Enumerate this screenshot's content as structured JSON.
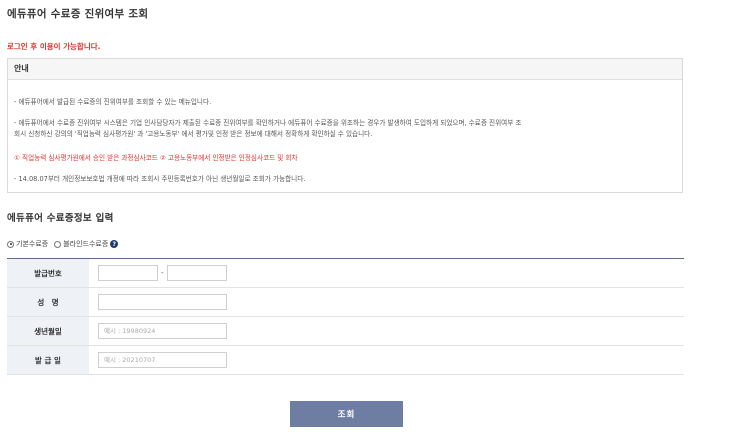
{
  "page": {
    "title": "에듀퓨어 수료증 진위여부 조회"
  },
  "login_notice": "로그인 후 이용이 가능합니다.",
  "notice": {
    "heading": "안내",
    "lines": [
      "- 에듀퓨어에서 발급된 수료증의 진위여부를 조회할 수 있는 메뉴입니다.",
      "- 에듀퓨어에서 수료증 진위여부 시스템은 기업 인사담당자가 제출된 수료증 진위여부를 확인하거나 에듀퓨어 수료증을 위조하는 경우가 발생하여 도입하게 되었으며, 수료증 진위여부 조",
      "회시 신청하신 강의의 '직업능력 심사평가원' 과 '고용노동부' 에서 평가및 인정 받은 정보에 대해서 정확하게 확인하실 수 있습니다.",
      "① 직업능력 심사평가원에서 승인 받은 과정심사코드 ② 고용노동부에서 인정받은 인정심사코드 및 회차",
      "- 14.08.07부터 개인정보보호법 개정에 따라 조회시 주민등록번호가 아닌 생년월일로 조회가 가능합니다."
    ]
  },
  "form": {
    "section_title": "에듀퓨어 수료증정보 입력",
    "radio_basic": "기본수료증",
    "radio_blind": "블라인드수료증",
    "issue_no_label": "발급번호",
    "issue_no_dash": "-",
    "name_label": "성　명",
    "birth_label": "생년월일",
    "birth_placeholder": "예시 : 19980924",
    "issue_date_label": "발 급 일",
    "issue_date_placeholder": "예시 : 20210707"
  },
  "search_button": "조회",
  "colors": {
    "accent": "#6e7ea3",
    "alert": "#e0322b",
    "header_bg": "#eef1f6"
  }
}
